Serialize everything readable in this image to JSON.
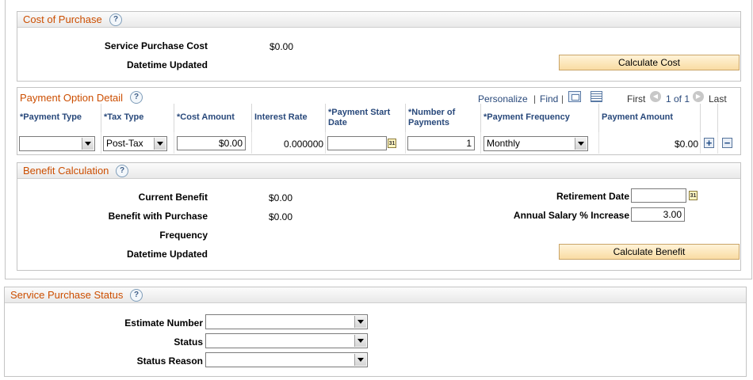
{
  "cost_of_purchase": {
    "title": "Cost of Purchase",
    "help": "?",
    "service_purchase_cost_label": "Service Purchase Cost",
    "service_purchase_cost_value": "$0.00",
    "datetime_updated_label": "Datetime Updated",
    "calculate_cost_button": "Calculate Cost"
  },
  "payment_option_detail": {
    "title": "Payment Option Detail",
    "help": "?",
    "toolbar": {
      "personalize": "Personalize",
      "separator": "|",
      "find": "Find",
      "first": "First",
      "page_indicator": "1 of 1",
      "last": "Last"
    },
    "columns": {
      "payment_type": "*Payment Type",
      "tax_type": "*Tax Type",
      "cost_amount": "*Cost Amount",
      "interest_rate": "Interest Rate",
      "payment_start_date": "*Payment Start Date",
      "number_of_payments": "*Number of Payments",
      "payment_frequency": "*Payment Frequency",
      "payment_amount": "Payment Amount"
    },
    "row": {
      "payment_type": "",
      "tax_type": "Post-Tax",
      "cost_amount": "$0.00",
      "interest_rate": "0.000000",
      "payment_start_date": "",
      "number_of_payments": "1",
      "payment_frequency": "Monthly",
      "payment_amount": "$0.00"
    },
    "add_row": "+",
    "delete_row": "−"
  },
  "benefit_calculation": {
    "title": "Benefit Calculation",
    "help": "?",
    "current_benefit_label": "Current Benefit",
    "current_benefit_value": "$0.00",
    "benefit_with_purchase_label": "Benefit with Purchase",
    "benefit_with_purchase_value": "$0.00",
    "frequency_label": "Frequency",
    "datetime_updated_label": "Datetime Updated",
    "retirement_date_label": "Retirement Date",
    "retirement_date_value": "",
    "annual_salary_increase_label": "Annual Salary % Increase",
    "annual_salary_increase_value": "3.00",
    "calculate_benefit_button": "Calculate Benefit"
  },
  "service_purchase_status": {
    "title": "Service Purchase Status",
    "help": "?",
    "estimate_number_label": "Estimate Number",
    "estimate_number_value": "",
    "status_label": "Status",
    "status_value": "",
    "status_reason_label": "Status Reason",
    "status_reason_value": ""
  },
  "icons": {
    "calendar": "31",
    "prev": "◀",
    "next": "▶"
  }
}
